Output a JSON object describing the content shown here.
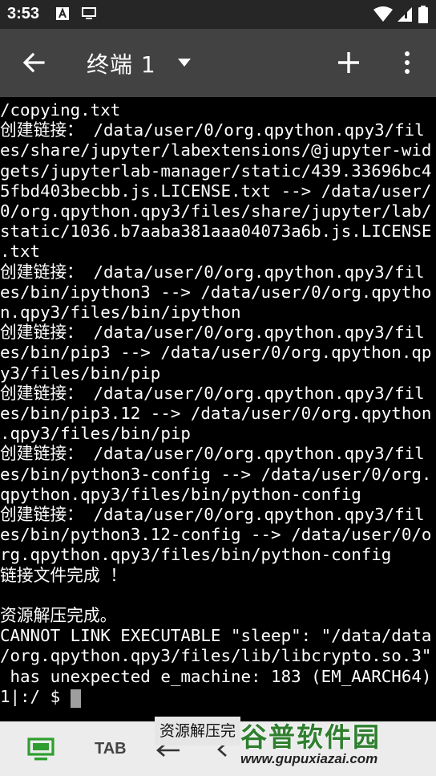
{
  "status_bar": {
    "time": "3:53"
  },
  "app_bar": {
    "title": "终端 1"
  },
  "terminal": {
    "lines": [
      "/copying.txt",
      "创建链接： /data/user/0/org.qpython.qpy3/fil",
      "es/share/jupyter/labextensions/@jupyter-wid",
      "gets/jupyterlab-manager/static/439.33696bc4",
      "5fbd403becbb.js.LICENSE.txt --> /data/user/",
      "0/org.qpython.qpy3/files/share/jupyter/lab/",
      "static/1036.b7aaba381aaa04073a6b.js.LICENSE",
      ".txt",
      "创建链接： /data/user/0/org.qpython.qpy3/fil",
      "es/bin/ipython3 --> /data/user/0/org.qpytho",
      "n.qpy3/files/bin/ipython",
      "创建链接： /data/user/0/org.qpython.qpy3/fil",
      "es/bin/pip3 --> /data/user/0/org.qpython.qp",
      "y3/files/bin/pip",
      "创建链接： /data/user/0/org.qpython.qpy3/fil",
      "es/bin/pip3.12 --> /data/user/0/org.qpython",
      ".qpy3/files/bin/pip",
      "创建链接： /data/user/0/org.qpython.qpy3/fil",
      "es/bin/python3-config --> /data/user/0/org.",
      "qpython.qpy3/files/bin/python-config",
      "创建链接： /data/user/0/org.qpython.qpy3/fil",
      "es/bin/python3.12-config --> /data/user/0/o",
      "rg.qpython.qpy3/files/bin/python-config",
      "链接文件完成 ！",
      "",
      "资源解压完成。",
      "CANNOT LINK EXECUTABLE \"sleep\": \"/data/data",
      "/org.qpython.qpy3/files/lib/libcrypto.so.3\"",
      " has unexpected e_machine: 183 (EM_AARCH64)",
      "1|:/ $ "
    ]
  },
  "bottom_bar": {
    "tab_label": "TAB"
  },
  "toast": {
    "text": "资源解压完"
  },
  "watermark": {
    "brand": "谷普软件园",
    "url": "www.gupuxiazai.com"
  },
  "colors": {
    "status_bar": "#262626",
    "app_bar": "#424242",
    "terminal_bg": "#000000",
    "terminal_fg": "#ffffff",
    "cursor": "#9e9e9e",
    "bottom_bar": "#ececec",
    "keyboard_icon": "#2e9e2e"
  }
}
